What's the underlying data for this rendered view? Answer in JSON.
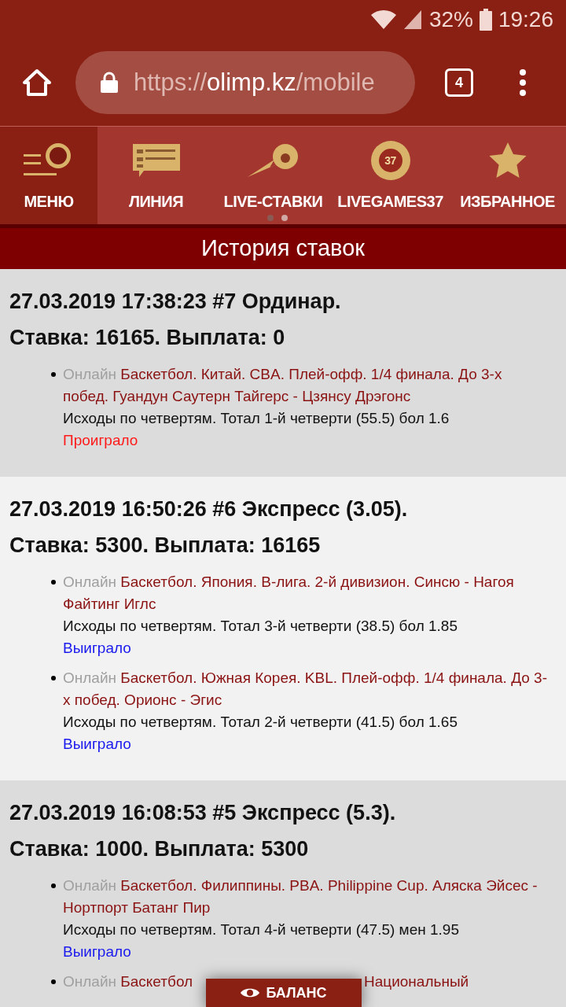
{
  "status_bar": {
    "battery": "32%",
    "time": "19:26"
  },
  "browser": {
    "url_scheme": "https://",
    "url_host": "olimp.kz",
    "url_path": "/mobile",
    "tab_count": "4"
  },
  "nav": {
    "tabs": [
      {
        "label": "МЕНЮ",
        "kind": "menu",
        "selected": true
      },
      {
        "label": "ЛИНИЯ",
        "kind": "line",
        "selected": false
      },
      {
        "label": "LIVE-СТАВКИ",
        "kind": "live",
        "selected": false
      },
      {
        "label": "LIVEGAMES37",
        "kind": "games",
        "icon_text": "37",
        "selected": false
      },
      {
        "label": "ИЗБРАННОЕ",
        "kind": "favorites",
        "selected": false
      }
    ],
    "pages": [
      {
        "selected": false
      },
      {
        "selected": true
      }
    ]
  },
  "page_title": "История ставок",
  "bets": [
    {
      "header": "27.03.2019 17:38:23 #7 Ординар.",
      "summary": "Ставка: 16165. Выплата: 0",
      "items": [
        {
          "tag": "Онлайн",
          "event": "Баскетбол. Китай. CBA. Плей-офф. 1/4 финала. До 3-х побед. Гуандун Саутерн Тайгерс - Цзянсу Дрэгонс",
          "market": "Исходы по четвертям. Тотал 1-й четверти (55.5) бол 1.6",
          "result": "Проиграло",
          "kind": "lost"
        }
      ]
    },
    {
      "header": "27.03.2019 16:50:26 #6 Экспресс (3.05).",
      "summary": "Ставка: 5300. Выплата: 16165",
      "items": [
        {
          "tag": "Онлайн",
          "event": "Баскетбол. Япония. B-лига. 2-й дивизион. Синсю - Нагоя Файтинг Иглс",
          "market": "Исходы по четвертям. Тотал 3-й четверти (38.5) бол 1.85",
          "result": "Выиграло",
          "kind": "won"
        },
        {
          "tag": "Онлайн",
          "event": "Баскетбол. Южная Корея. KBL. Плей-офф. 1/4 финала. До 3-х побед. Орионс - Эгис",
          "market": "Исходы по четвертям. Тотал 2-й четверти (41.5) бол 1.65",
          "result": "Выиграло",
          "kind": "won"
        }
      ]
    },
    {
      "header": "27.03.2019 16:08:53 #5 Экспресс (5.3).",
      "summary": "Ставка: 1000. Выплата: 5300",
      "items": [
        {
          "tag": "Онлайн",
          "event": "Баскетбол. Филиппины. PBA. Philippine Cup. Аляска Эйсес - Нортпорт Батанг Пир",
          "market": "Исходы по четвертям. Тотал 4-й четверти (47.5) мен 1.95",
          "result": "Выиграло",
          "kind": "won"
        }
      ]
    }
  ],
  "covered_item": {
    "tag": "Онлайн",
    "lines": [
      [
        "Баскетбол",
        "Национальный"
      ]
    ]
  },
  "balance_button": "БАЛАНС"
}
